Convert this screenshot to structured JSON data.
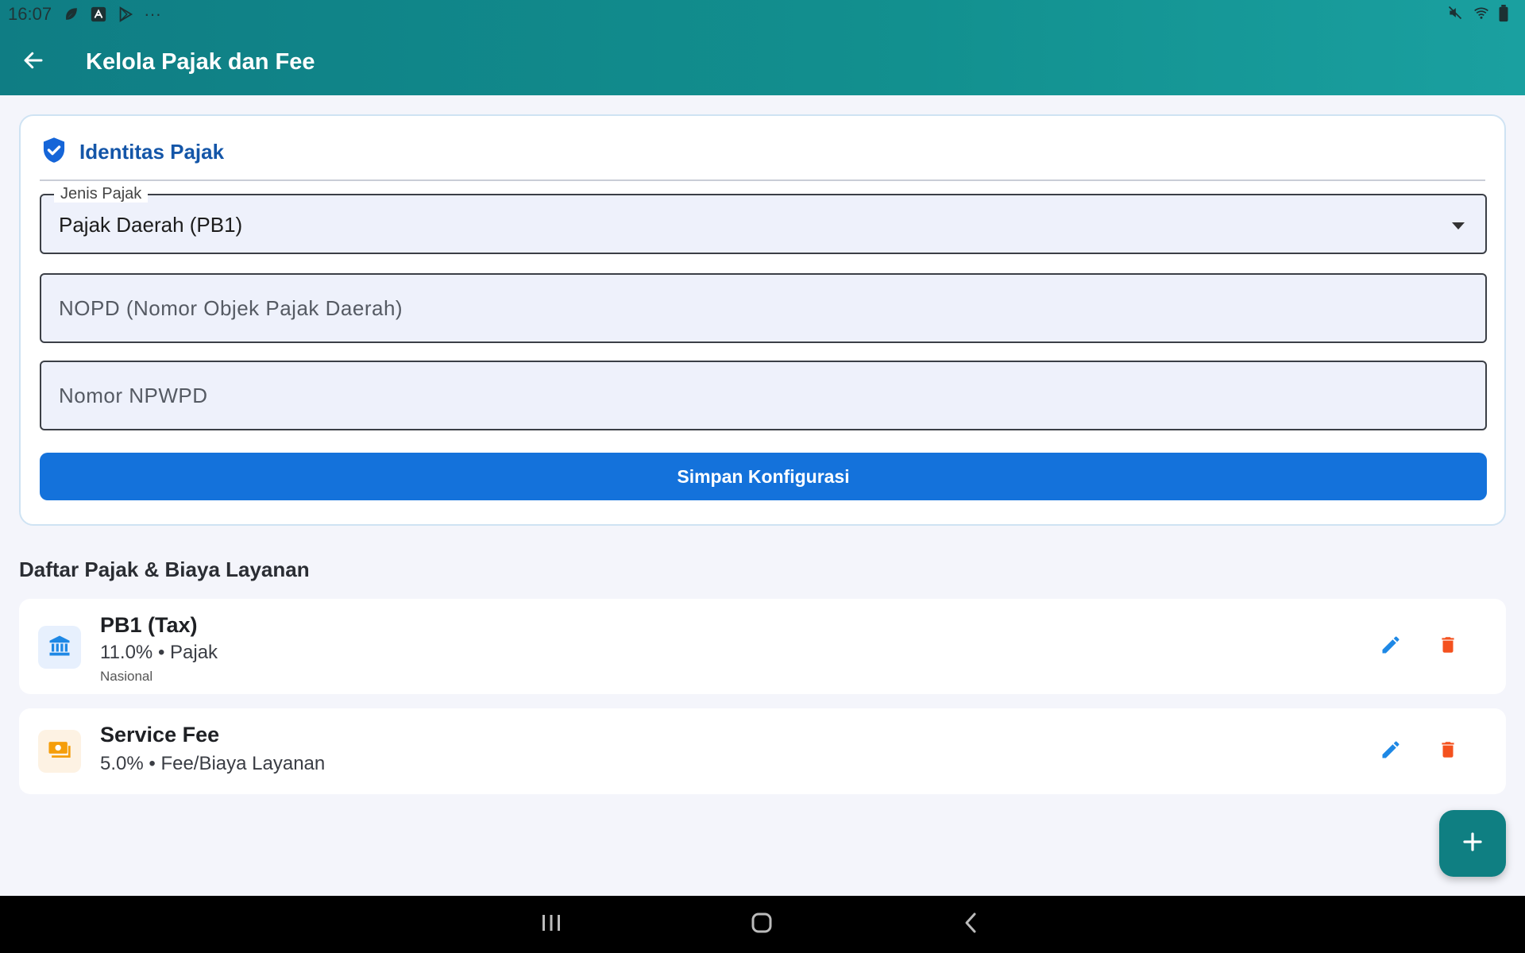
{
  "status_bar": {
    "time": "16:07",
    "overflow": "···",
    "icons_left": [
      "leaf-icon",
      "app-store-icon",
      "play-store-icon"
    ],
    "icons_right": [
      "mute-icon",
      "wifi-icon",
      "battery-icon"
    ]
  },
  "app_bar": {
    "title": "Kelola Pajak dan Fee",
    "back_icon": "arrow-left-icon",
    "color": "#0f7d84"
  },
  "identity_card": {
    "title": "Identitas Pajak",
    "icon": "shield-check-icon",
    "tax_type": {
      "label": "Jenis Pajak",
      "value": "Pajak Daerah (PB1)"
    },
    "nopd": {
      "placeholder": "NOPD (Nomor Objek Pajak Daerah)",
      "value": ""
    },
    "npwpd": {
      "placeholder": "Nomor NPWPD",
      "value": ""
    },
    "save_label": "Simpan Konfigurasi",
    "save_color": "#1472db"
  },
  "list_section": {
    "title": "Daftar Pajak & Biaya Layanan",
    "items": [
      {
        "name": "PB1 (Tax)",
        "detail": "11.0% • Pajak",
        "scope": "Nasional",
        "icon": "bank-icon",
        "icon_color": "#1e88e5"
      },
      {
        "name": "Service Fee",
        "detail": "5.0% • Fee/Biaya Layanan",
        "icon": "money-icon",
        "icon_color": "#f59e0b"
      }
    ],
    "edit_color": "#1e88e5",
    "delete_color": "#f4511e"
  },
  "fab": {
    "icon": "plus-icon"
  },
  "nav_bar": {
    "buttons": [
      "recent-apps-icon",
      "home-icon",
      "back-icon"
    ]
  }
}
